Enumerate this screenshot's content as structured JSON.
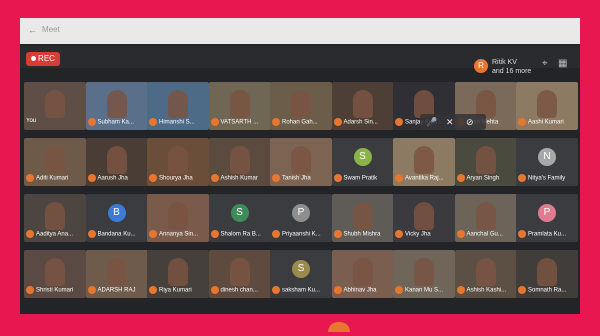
{
  "window": {
    "back_glyph": "←",
    "tab_text": "Meet"
  },
  "meeting": {
    "rec_label": "REC",
    "presenter": {
      "initial": "R",
      "line1": "Ritik KV",
      "line2": "and 16 more"
    }
  },
  "participants": [
    {
      "label": "You",
      "kind": "video",
      "bg": "#5f4e46"
    },
    {
      "label": "Subham Ka...",
      "kind": "video",
      "bg": "#5a6f8a"
    },
    {
      "label": "Himanshi S...",
      "kind": "video",
      "bg": "#4d6b86"
    },
    {
      "label": "VATSARTH ...",
      "kind": "video",
      "bg": "#6f6653"
    },
    {
      "label": "Rohan Gah...",
      "kind": "video",
      "bg": "#6b5d49"
    },
    {
      "label": "Adarsh Sin...",
      "kind": "video",
      "bg": "#4d3f36"
    },
    {
      "label": "Sanjay Kum...",
      "kind": "video",
      "bg": "#2f2f35"
    },
    {
      "label": "Aksh Mehta",
      "kind": "video",
      "bg": "#7b6a59"
    },
    {
      "label": "Aashi Kumari",
      "kind": "video",
      "bg": "#8c7a63"
    },
    {
      "label": "Aditi Kumari",
      "kind": "video",
      "bg": "#6e5a48"
    },
    {
      "label": "Aarush Jha",
      "kind": "video",
      "bg": "#4a3d35"
    },
    {
      "label": "Shourya Jha",
      "kind": "video",
      "bg": "#6a4e3a"
    },
    {
      "label": "Ashish Kumar",
      "kind": "video",
      "bg": "#5b4a3e"
    },
    {
      "label": "Tanish Jha",
      "kind": "video",
      "bg": "#7d6452"
    },
    {
      "label": "Swam Pratik",
      "kind": "avatar",
      "initial": "S",
      "color": "#8bb34a",
      "bg": "#3b3c40"
    },
    {
      "label": "Avantika Raj...",
      "kind": "video",
      "bg": "#8d7a62"
    },
    {
      "label": "Aryan Singh",
      "kind": "video",
      "bg": "#4a4a3e"
    },
    {
      "label": "Nitya's Family",
      "kind": "avatar",
      "initial": "N",
      "color": "#a8a8a8",
      "bg": "#3b3c40"
    },
    {
      "label": "Aaditya Ana...",
      "kind": "video",
      "bg": "#4d4540"
    },
    {
      "label": "Bandana Ku...",
      "kind": "avatar",
      "initial": "B",
      "color": "#3a7bd5",
      "bg": "#3b3c40"
    },
    {
      "label": "Annanya Sin...",
      "kind": "video",
      "bg": "#7a5a4a"
    },
    {
      "label": "Shalom Ra B...",
      "kind": "avatar",
      "initial": "S",
      "color": "#3d8b5a",
      "bg": "#3b3c40"
    },
    {
      "label": "Priyaanshi K...",
      "kind": "avatar",
      "initial": "P",
      "color": "#8e8e8e",
      "bg": "#3b3c40"
    },
    {
      "label": "Shubh Mishra",
      "kind": "video",
      "bg": "#5f5c58"
    },
    {
      "label": "Vicky Jha",
      "kind": "video",
      "bg": "#3a3a3f"
    },
    {
      "label": "Aanchal Gu...",
      "kind": "video",
      "bg": "#6c6458"
    },
    {
      "label": "Pramlata Ku...",
      "kind": "avatar",
      "initial": "P",
      "color": "#e07b91",
      "bg": "#3b3c40"
    },
    {
      "label": "Shristi Kumari",
      "kind": "video",
      "bg": "#5b4a43"
    },
    {
      "label": "ADARSH RAJ",
      "kind": "video",
      "bg": "#6e5b4c"
    },
    {
      "label": "Riya Kumari",
      "kind": "video",
      "bg": "#45403b"
    },
    {
      "label": "dinesh chan...",
      "kind": "video",
      "bg": "#5e4a3f"
    },
    {
      "label": "saksham Ku...",
      "kind": "avatar",
      "initial": "S",
      "color": "#9b8b4a",
      "bg": "#3b3c40"
    },
    {
      "label": "Abhinav Jha",
      "kind": "video",
      "bg": "#7a5f50"
    },
    {
      "label": "Kanan Mu S...",
      "kind": "video",
      "bg": "#6f6559"
    },
    {
      "label": "Ashish Kashi...",
      "kind": "video",
      "bg": "#5c4f44"
    },
    {
      "label": "Somnath Ra...",
      "kind": "video",
      "bg": "#403d3b"
    }
  ]
}
